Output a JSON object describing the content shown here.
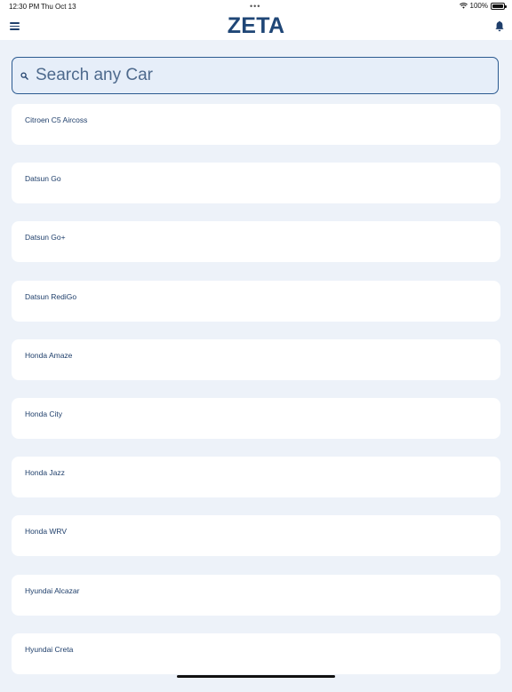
{
  "status_bar": {
    "time": "12:30 PM",
    "date": "Thu Oct 13",
    "dots": "•••",
    "battery": "100%",
    "icons": [
      "wifi-icon",
      "battery-icon"
    ]
  },
  "header": {
    "title": "ZETA",
    "icons": [
      "hamburger-menu-icon",
      "bell-icon"
    ]
  },
  "search": {
    "placeholder": "Search any Car",
    "value": "",
    "icon": "search-icon"
  },
  "cars": [
    {
      "label": "Citroen C5 Aircoss"
    },
    {
      "label": "Datsun Go"
    },
    {
      "label": "Datsun Go+"
    },
    {
      "label": "Datsun RediGo"
    },
    {
      "label": "Honda Amaze"
    },
    {
      "label": "Honda City"
    },
    {
      "label": "Honda Jazz"
    },
    {
      "label": "Honda WRV"
    },
    {
      "label": "Hyundai Alcazar"
    },
    {
      "label": "Hyundai Creta"
    }
  ],
  "colors": {
    "brand": "#1f4676",
    "background": "#edf2f9",
    "card": "#ffffff",
    "search_border": "#2b5a90"
  }
}
